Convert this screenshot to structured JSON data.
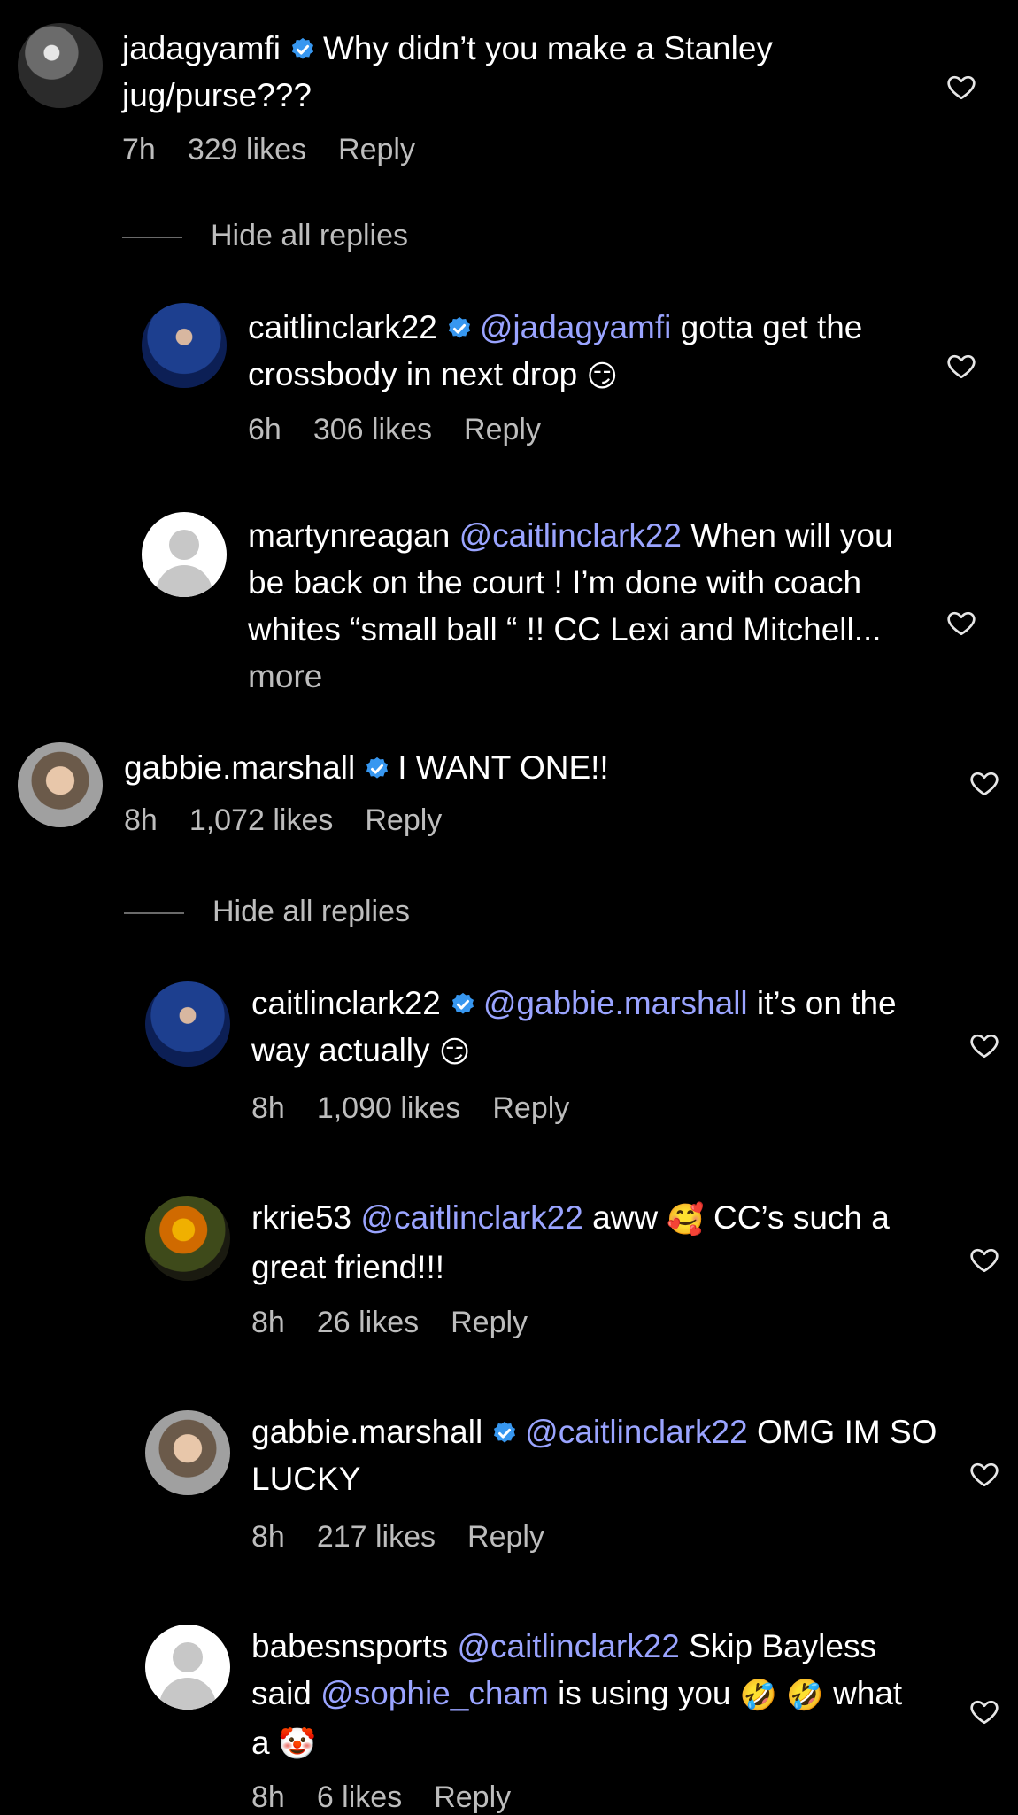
{
  "comments": [
    {
      "username": "jadagyamfi",
      "verified": true,
      "text": "Why didn’t you make a Stanley jug/purse???",
      "time": "7h",
      "likes": "329 likes",
      "reply": "Reply"
    },
    {
      "username": "caitlinclark22",
      "verified": true,
      "mention": "@jadagyamfi",
      "text": "gotta get the crossbody in next drop",
      "emoji": "😏",
      "time": "6h",
      "likes": "306 likes",
      "reply": "Reply"
    },
    {
      "username": "martynreagan",
      "verified": false,
      "mention": "@caitlinclark22",
      "text": "When will you be back on the court ! I’m done with coach whites “small ball “ !! CC Lexi and Mitchell...",
      "more": "more"
    },
    {
      "username": "gabbie.marshall",
      "verified": true,
      "text": "I WANT ONE!!",
      "time": "8h",
      "likes": "1,072 likes",
      "reply": "Reply"
    },
    {
      "username": "caitlinclark22",
      "verified": true,
      "mention": "@gabbie.marshall",
      "text": "it’s on the way actually",
      "emoji": "😏",
      "time": "8h",
      "likes": "1,090 likes",
      "reply": "Reply"
    },
    {
      "username": "rkrie53",
      "verified": false,
      "mention": "@caitlinclark22",
      "text_a": "aww",
      "emoji": "🥰",
      "text_b": "CC’s such a great friend!!!",
      "time": "8h",
      "likes": "26 likes",
      "reply": "Reply"
    },
    {
      "username": "gabbie.marshall",
      "verified": true,
      "mention": "@caitlinclark22",
      "text": "OMG IM SO LUCKY",
      "time": "8h",
      "likes": "217 likes",
      "reply": "Reply"
    },
    {
      "username": "babesnsports",
      "verified": false,
      "mention": "@caitlinclark22",
      "text_a": "Skip Bayless said",
      "mention_b": "@sophie_cham",
      "text_b": "is using you",
      "emoji_a": "🤣",
      "emoji_b": "🤣",
      "text_c": "what a",
      "emoji_c": "🤡",
      "time": "8h",
      "likes": "6 likes",
      "reply": "Reply"
    }
  ],
  "toggles": {
    "hide_all_replies": "Hide all replies"
  },
  "colors": {
    "background": "#000000",
    "mention": "#9aa4ff",
    "meta": "#bdbdbd",
    "verified": "#3797f0"
  }
}
